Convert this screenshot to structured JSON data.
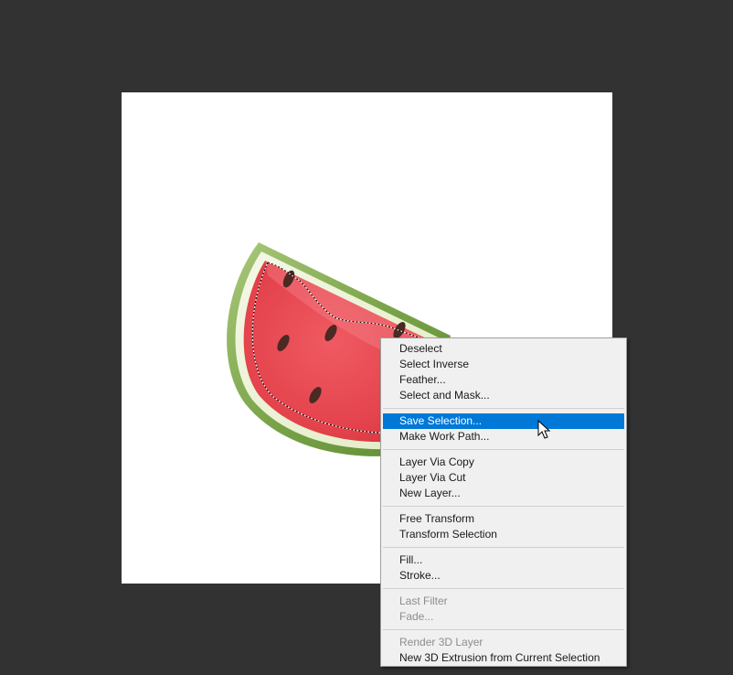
{
  "context_menu": {
    "groups": [
      [
        {
          "label": "Deselect",
          "enabled": true
        },
        {
          "label": "Select Inverse",
          "enabled": true
        },
        {
          "label": "Feather...",
          "enabled": true
        },
        {
          "label": "Select and Mask...",
          "enabled": true
        }
      ],
      [
        {
          "label": "Save Selection...",
          "enabled": true,
          "highlighted": true
        },
        {
          "label": "Make Work Path...",
          "enabled": true
        }
      ],
      [
        {
          "label": "Layer Via Copy",
          "enabled": true
        },
        {
          "label": "Layer Via Cut",
          "enabled": true
        },
        {
          "label": "New Layer...",
          "enabled": true
        }
      ],
      [
        {
          "label": "Free Transform",
          "enabled": true
        },
        {
          "label": "Transform Selection",
          "enabled": true
        }
      ],
      [
        {
          "label": "Fill...",
          "enabled": true
        },
        {
          "label": "Stroke...",
          "enabled": true
        }
      ],
      [
        {
          "label": "Last Filter",
          "enabled": false
        },
        {
          "label": "Fade...",
          "enabled": false
        }
      ],
      [
        {
          "label": "Render 3D Layer",
          "enabled": false
        },
        {
          "label": "New 3D Extrusion from Current Selection",
          "enabled": true
        }
      ]
    ]
  },
  "colors": {
    "workspace_bg": "#323232",
    "canvas_bg": "#ffffff",
    "menu_bg": "#f0f0f0",
    "highlight": "#0078d7",
    "rind_green": "#6f9a3a",
    "flesh_red": "#e8454d"
  },
  "icons": {
    "cursor": "arrow-pointer-icon",
    "artwork": "watermelon-slice"
  }
}
